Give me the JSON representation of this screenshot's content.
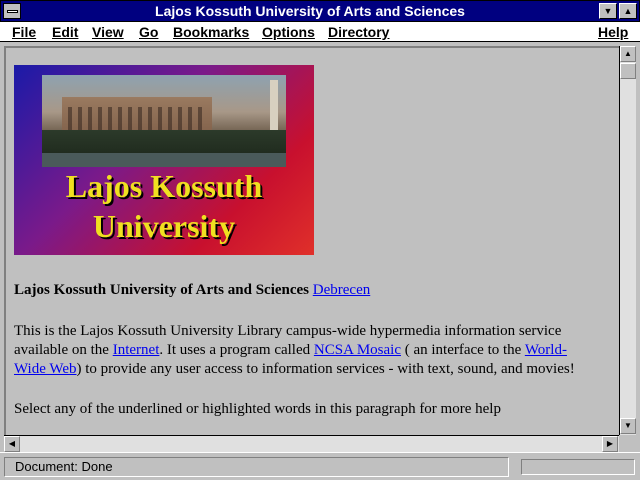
{
  "window": {
    "title": "Lajos Kossuth University of Arts and Sciences"
  },
  "menu": {
    "items": [
      "File",
      "Edit",
      "View",
      "Go",
      "Bookmarks",
      "Options",
      "Directory"
    ],
    "help": "Help"
  },
  "content": {
    "banner": {
      "line1": "Lajos Kossuth",
      "line2": "University"
    },
    "heading": {
      "bold": "Lajos Kossuth University of Arts and Sciences",
      "link": "Debrecen"
    },
    "para1": {
      "t1": "This is the Lajos Kossuth University Library campus-wide hypermedia information service available on the ",
      "link1": "Internet",
      "t2": ". It uses a program called ",
      "link2": "NCSA Mosaic",
      "t3": " ( an interface to the ",
      "link3": "World-Wide Web",
      "t4": ") to provide any user access to information services - with text, sound, and movies!"
    },
    "para2": "Select any of the underlined or highlighted words in this paragraph for more help"
  },
  "status": {
    "text": "Document: Done"
  }
}
